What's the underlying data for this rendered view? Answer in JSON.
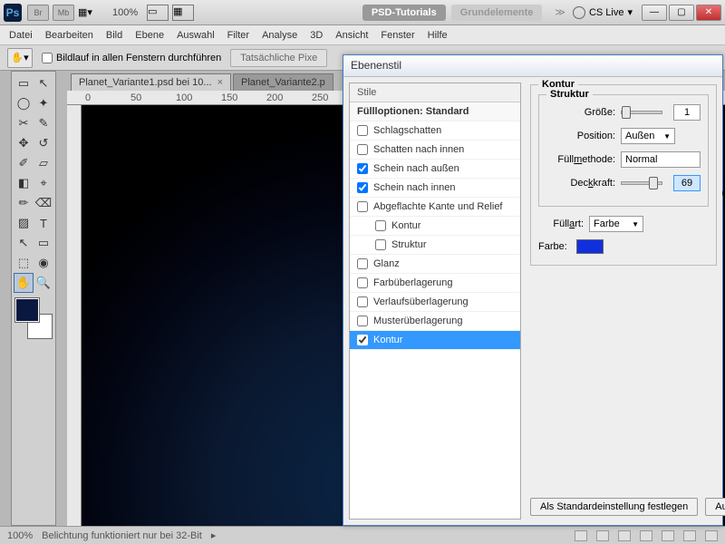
{
  "titlebar": {
    "ps": "Ps",
    "br": "Br",
    "mb": "Mb",
    "zoom": "100%",
    "pill1": "PSD-Tutorials",
    "pill2": "Grundelemente",
    "cslive": "CS Live"
  },
  "menu": [
    "Datei",
    "Bearbeiten",
    "Bild",
    "Ebene",
    "Auswahl",
    "Filter",
    "Analyse",
    "3D",
    "Ansicht",
    "Fenster",
    "Hilfe"
  ],
  "options": {
    "scroll_all": "Bildlauf in allen Fenstern durchführen",
    "actual_px": "Tatsächliche Pixe"
  },
  "tabs": {
    "t1": "Planet_Variante1.psd bei 10...",
    "t2": "Planet_Variante2.p"
  },
  "ruler": {
    "m0": "0",
    "m50": "50",
    "m100": "100",
    "m150": "150",
    "m200": "200",
    "m250": "250"
  },
  "status": {
    "zoom": "100%",
    "msg": "Belichtung funktioniert nur bei 32-Bit"
  },
  "tools": [
    "▭",
    "↖",
    "◯",
    "✦",
    "✂",
    "✎",
    "✥",
    "↺",
    "✐",
    "▱",
    "◧",
    "⌖",
    "✏",
    "⌫",
    "▨",
    "●",
    "◐",
    "▼",
    "⚫",
    "✎",
    "✒",
    "T",
    "↖",
    "▭",
    "✋",
    "🔍"
  ],
  "dialog": {
    "title": "Ebenenstil",
    "styles_hdr": "Stile",
    "fill_opts": "Füllloptionen: Standard",
    "items": {
      "schlagschatten": "Schlagschatten",
      "schatten_innen": "Schatten nach innen",
      "schein_aussen": "Schein nach außen",
      "schein_innen": "Schein nach innen",
      "kante_relief": "Abgeflachte Kante und Relief",
      "kontur_sub": "Kontur",
      "struktur_sub": "Struktur",
      "glanz": "Glanz",
      "farbueber": "Farbüberlagerung",
      "verlaufueber": "Verlaufsüberlagerung",
      "musterueber": "Musterüberlagerung",
      "kontur": "Kontur"
    },
    "right": {
      "kontur_legend": "Kontur",
      "struktur_legend": "Struktur",
      "groesse": "Größe:",
      "groesse_val": "1",
      "position": "Position:",
      "position_val": "Außen",
      "fuellmethode": "Füllmethode:",
      "fuellmethode_val": "Normal",
      "deckkraft": "Deckkraft:",
      "deckkraft_val": "69",
      "fuellart": "Füllart:",
      "fuellart_val": "Farbe",
      "farbe": "Farbe:",
      "btn_default": "Als Standardeinstellung festlegen",
      "btn_reset": "Auf Stand"
    }
  }
}
